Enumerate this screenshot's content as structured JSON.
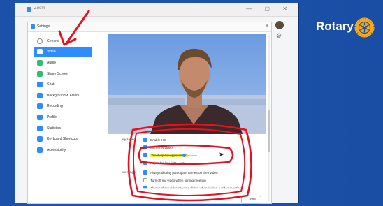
{
  "zoom_window": {
    "title": "Zoom"
  },
  "settings": {
    "title": "Settings",
    "nav": [
      {
        "label": "General",
        "color": "#ffffff",
        "active": false
      },
      {
        "label": "Video",
        "color": "#ffffff",
        "active": true
      },
      {
        "label": "Audio",
        "color": "#2fbf71",
        "active": false
      },
      {
        "label": "Share Screen",
        "color": "#2fbf71",
        "active": false
      },
      {
        "label": "Chat",
        "color": "#2d8cff",
        "active": false
      },
      {
        "label": "Background & Filters",
        "color": "#2d8cff",
        "active": false
      },
      {
        "label": "Recording",
        "color": "#2d8cff",
        "active": false
      },
      {
        "label": "Profile",
        "color": "#2d8cff",
        "active": false
      },
      {
        "label": "Statistics",
        "color": "#2d8cff",
        "active": false
      },
      {
        "label": "Keyboard Shortcuts",
        "color": "#2d8cff",
        "active": false
      },
      {
        "label": "Accessibility",
        "color": "#2d8cff",
        "active": false
      }
    ],
    "my_video": {
      "label": "My Video",
      "options": [
        {
          "label": "Enable HD",
          "checked": true
        },
        {
          "label": "Mirror my video",
          "checked": true
        },
        {
          "label": "Touch up my appearance",
          "checked": true,
          "highlighted": true
        },
        {
          "label": "Adjust for low light",
          "suffix": "Auto",
          "checked": true
        }
      ],
      "touch_up_level": 0.7
    },
    "meetings": {
      "label": "Meetings",
      "options": [
        {
          "label": "Always display participant names on their video",
          "checked": true
        },
        {
          "label": "Turn off my video when joining meeting",
          "checked": false
        },
        {
          "label": "Always show video preview dialog when joining a video meeting",
          "checked": true
        }
      ]
    },
    "close_label": "Close"
  },
  "branding": {
    "name": "Rotary",
    "color": "#ffffff",
    "wheel_color": "#f7a81b"
  },
  "colors": {
    "accent": "#2d8cff",
    "annotation": "#e8101c",
    "highlight": "#f4f045",
    "background": "#1a4fa6"
  }
}
